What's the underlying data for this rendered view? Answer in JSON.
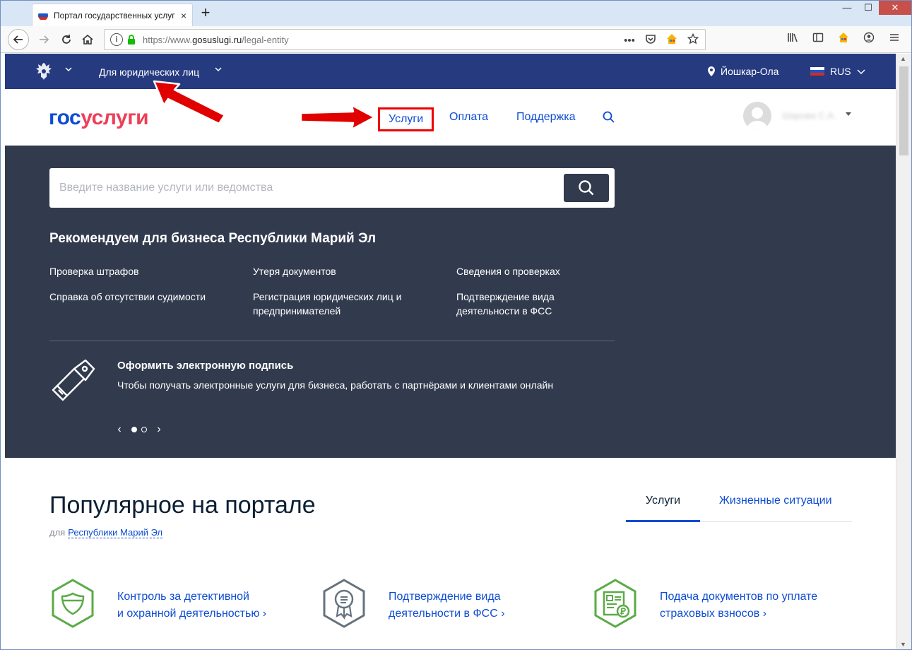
{
  "browser": {
    "tab_title": "Портал государственных услуг",
    "tab_close": "×",
    "new_tab": "+",
    "url_scheme": "https://www.",
    "url_domain": "gosuslugi.ru",
    "url_path": "/legal-entity",
    "win_minimize": "—",
    "win_maximize": "☐",
    "win_close": "✕"
  },
  "topbar": {
    "entity_link": "Для юридических лиц",
    "city": "Йошкар-Ола",
    "lang": "RUS"
  },
  "header": {
    "logo_gos": "гос",
    "logo_uslugi": "услуги",
    "menu": [
      "Услуги",
      "Оплата",
      "Поддержка"
    ],
    "user_name": "Шарова С.А."
  },
  "hero": {
    "search_placeholder": "Введите название услуги или ведомства",
    "rec_title": "Рекомендуем для бизнеса Республики Марий Эл",
    "rec_links": [
      "Проверка штрафов",
      "Утеря документов",
      "Сведения о проверках",
      "Справка об отсутствии судимости",
      "Регистрация юридических лиц и предпринимателей",
      "Подтверждение вида деятельности в ФСС"
    ],
    "sig_title": "Оформить электронную подпись",
    "sig_text": "Чтобы получать электронные услуги для бизнеса, работать с партнёрами и клиентами онлайн",
    "carousel_prev": "‹",
    "carousel_next": "›"
  },
  "popular": {
    "title": "Популярное на портале",
    "sub_prefix": "для",
    "region": "Республики Марий Эл",
    "tabs": [
      "Услуги",
      "Жизненные ситуации"
    ],
    "services": [
      {
        "line1": "Контроль за детективной",
        "line2": "и охранной деятельностью",
        "icon": "shield-icon"
      },
      {
        "line1": "Подтверждение вида",
        "line2": "деятельности в ФСС",
        "icon": "certificate-icon"
      },
      {
        "line1": "Подача документов по уплате",
        "line2": "страховых взносов",
        "icon": "document-ruble-icon"
      }
    ],
    "chevron": "›"
  },
  "colors": {
    "topbar": "#263a80",
    "hero": "#323b4e",
    "link": "#0d4cd3",
    "logo_red": "#ee3f58",
    "icon_green": "#5aab46",
    "icon_gray": "#66727f",
    "highlight_red": "#e00000"
  }
}
